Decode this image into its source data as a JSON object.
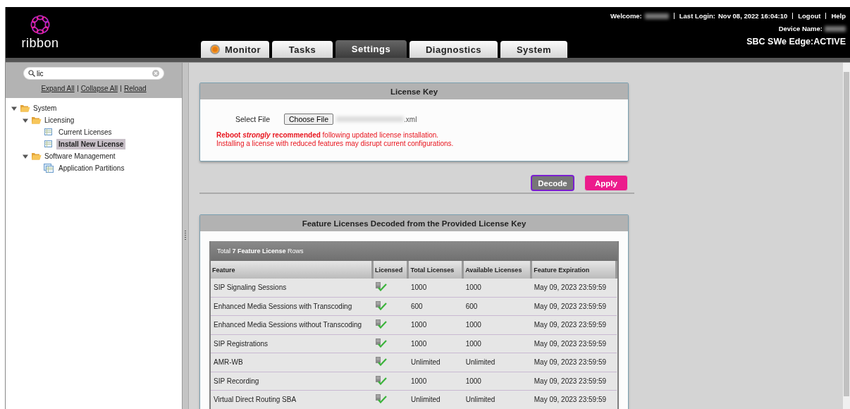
{
  "header": {
    "logo_text": "ribbon",
    "welcome_label": "Welcome:",
    "last_login_label": "Last Login:",
    "last_login": "Nov 08, 2022 16:04:10",
    "links": [
      "Logout",
      "Help"
    ],
    "device_name_label": "Device Name:",
    "status": "SBC SWe Edge:ACTIVE"
  },
  "tabs": [
    {
      "label": "Monitor",
      "selected": false,
      "kind": "status"
    },
    {
      "label": "Tasks",
      "selected": false,
      "kind": "plain"
    },
    {
      "label": "Settings",
      "selected": true,
      "kind": "plain"
    },
    {
      "label": "Diagnostics",
      "selected": false,
      "kind": "plain"
    },
    {
      "label": "System",
      "selected": false,
      "kind": "plain"
    }
  ],
  "sidebar": {
    "search": {
      "value": "lic"
    },
    "actions": [
      "Expand All",
      "Collapse All",
      "Reload"
    ],
    "tree": [
      {
        "label": "System",
        "kind": "folder",
        "expanded": true,
        "children": [
          {
            "label": "Licensing",
            "kind": "folder",
            "expanded": true,
            "children": [
              {
                "label": "Current Licenses",
                "kind": "table",
                "selected": false
              },
              {
                "label": "Install New License",
                "kind": "table",
                "selected": true
              }
            ]
          },
          {
            "label": "Software Management",
            "kind": "folder",
            "expanded": true,
            "children": [
              {
                "label": "Application Partitions",
                "kind": "tables",
                "selected": false
              }
            ]
          }
        ]
      }
    ]
  },
  "license_key": {
    "title": "License Key",
    "file_label": "Select File",
    "choose_button": "Choose File",
    "file_suffix": ".xml",
    "warning": "**Reboot *strongly* recommended** following updated license installation.",
    "note": "Installing a license with reduced features may disrupt current configurations."
  },
  "buttons": [
    {
      "label": "Decode",
      "kind": "secondary",
      "focused": true
    },
    {
      "label": "Apply",
      "kind": "primary",
      "focused": false
    }
  ],
  "features": {
    "title": "Feature Licenses Decoded from the Provided License Key",
    "summary": "Total **7 Feature License** Rows",
    "columns": [
      "Feature",
      "Licensed",
      "Total Licenses",
      "Available Licenses",
      "Feature Expiration"
    ],
    "rows": [
      {
        "feature": "SIP Signaling Sessions",
        "licensed": true,
        "total": "1000",
        "available": "1000",
        "expiration": "May 09, 2023 23:59:59"
      },
      {
        "feature": "Enhanced Media Sessions with Transcoding",
        "licensed": true,
        "total": "600",
        "available": "600",
        "expiration": "May 09, 2023 23:59:59"
      },
      {
        "feature": "Enhanced Media Sessions without Transcoding",
        "licensed": true,
        "total": "1000",
        "available": "1000",
        "expiration": "May 09, 2023 23:59:59"
      },
      {
        "feature": "SIP Registrations",
        "licensed": true,
        "total": "1000",
        "available": "1000",
        "expiration": "May 09, 2023 23:59:59"
      },
      {
        "feature": "AMR-WB",
        "licensed": true,
        "total": "Unlimited",
        "available": "Unlimited",
        "expiration": "May 09, 2023 23:59:59"
      },
      {
        "feature": "SIP Recording",
        "licensed": true,
        "total": "1000",
        "available": "1000",
        "expiration": "May 09, 2023 23:59:59"
      },
      {
        "feature": "Virtual Direct Routing SBA",
        "licensed": true,
        "total": "Unlimited",
        "available": "Unlimited",
        "expiration": "May 09, 2023 23:59:59"
      }
    ]
  }
}
